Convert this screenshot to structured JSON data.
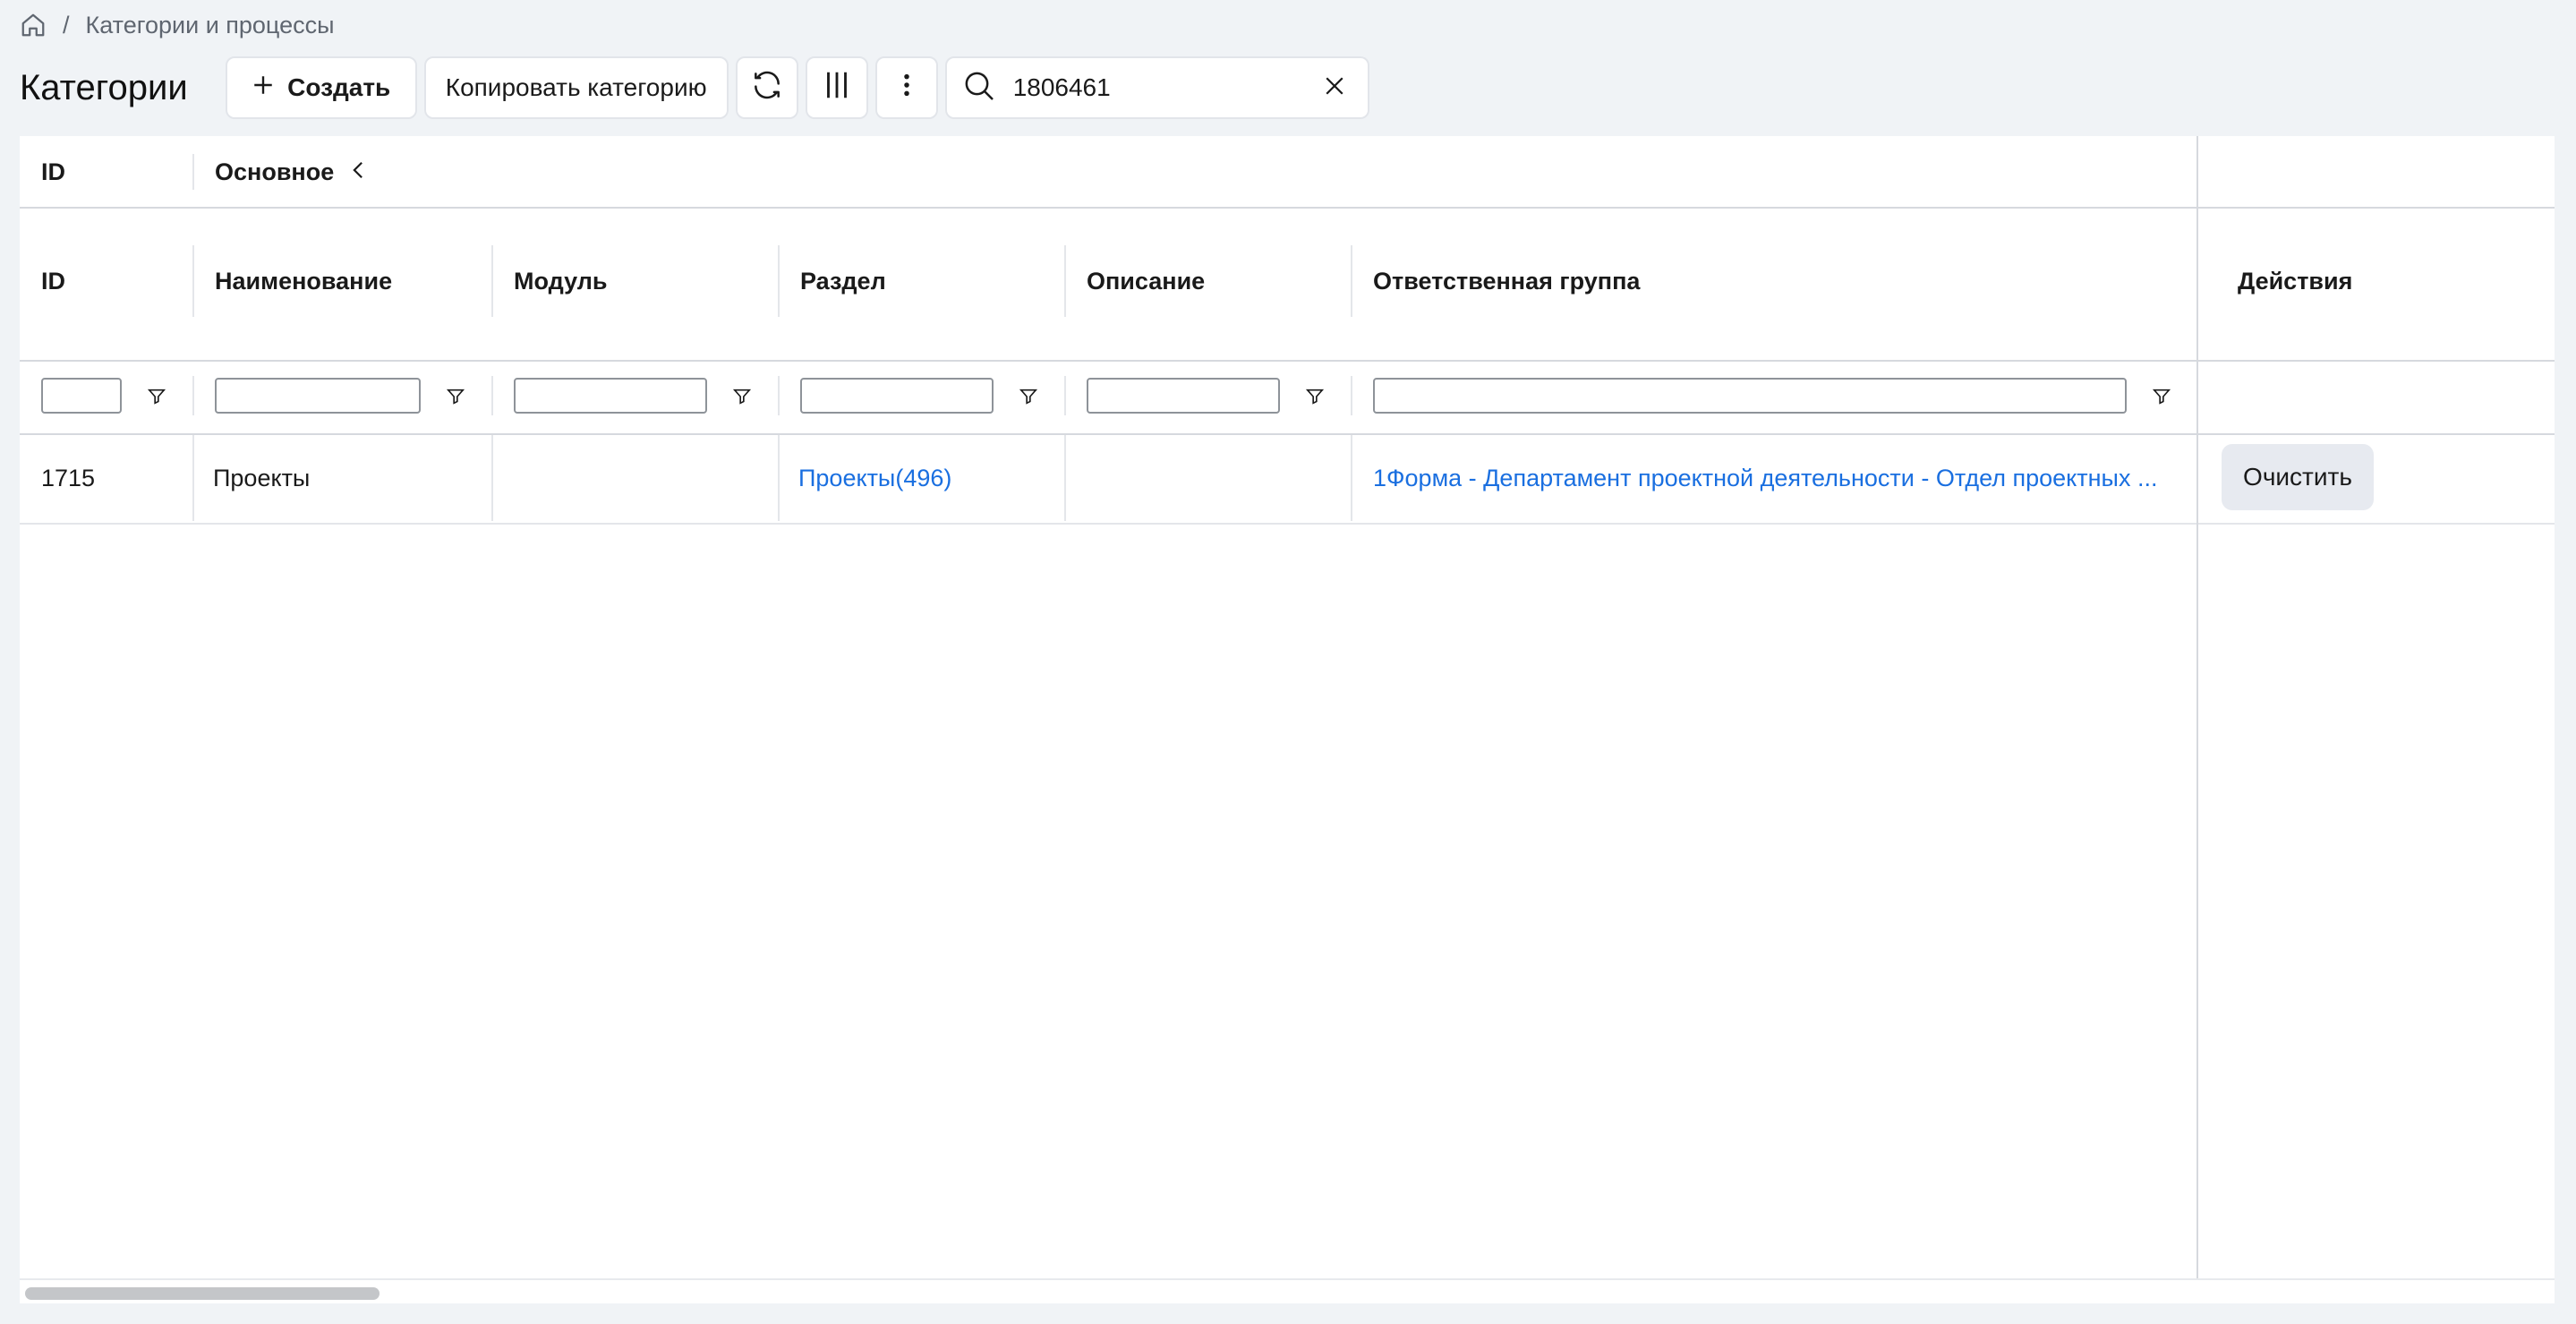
{
  "breadcrumb": {
    "home_icon": "home-icon",
    "separator": "/",
    "current": "Категории и процессы"
  },
  "toolbar": {
    "title": "Категории",
    "create_label": "Создать",
    "copy_label": "Копировать категорию",
    "refresh_icon": "refresh-icon",
    "columns_icon": "columns-icon",
    "more_icon": "more-vertical-icon",
    "search_value": "1806461",
    "search_icon": "search-icon",
    "clear_icon": "close-icon"
  },
  "table": {
    "group_headers": {
      "id": "ID",
      "main": "Основное",
      "main_collapse_icon": "chevron-left-icon"
    },
    "columns": [
      "ID",
      "Наименование",
      "Модуль",
      "Раздел",
      "Описание",
      "Ответственная группа",
      "Действия"
    ],
    "filter_icon": "filter-icon",
    "rows": [
      {
        "id": "1715",
        "name": "Проекты",
        "module": "",
        "section": "Проекты(496)",
        "description": "",
        "group": "1Форма - Департамент проектной деятельности - Отдел проектных ...",
        "action": "Очистить"
      }
    ]
  },
  "colors": {
    "link": "#1a6fe0",
    "background": "#f0f3f6",
    "panel": "#ffffff"
  }
}
